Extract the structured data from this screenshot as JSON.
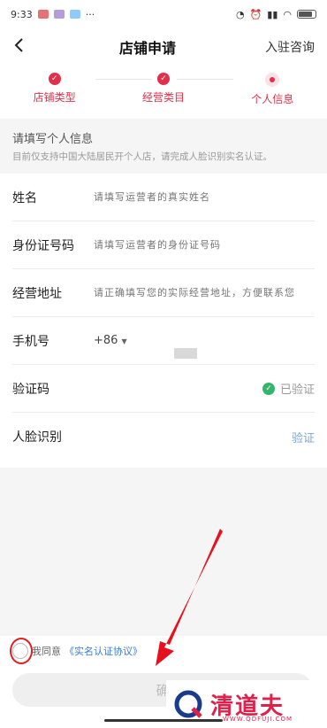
{
  "status_bar": {
    "time": "9:33",
    "dots": "···"
  },
  "nav": {
    "back_icon": "back-arrow-icon",
    "title": "店铺申请",
    "action": "入驻咨询"
  },
  "steps": [
    {
      "label": "店铺类型",
      "state": "done"
    },
    {
      "label": "经营类目",
      "state": "done"
    },
    {
      "label": "个人信息",
      "state": "current"
    }
  ],
  "info": {
    "title": "请填写个人信息",
    "desc": "目前仅支持中国大陆居民开个人店，请完成人脸识别实名认证。"
  },
  "form": {
    "name": {
      "label": "姓名",
      "placeholder": "请填写运营者的真实姓名"
    },
    "id_number": {
      "label": "身份证号码",
      "placeholder": "请填写运营者的身份证号码"
    },
    "address": {
      "label": "经营地址",
      "placeholder": "请正确填写您的实际经营地址，方便联系您"
    },
    "phone": {
      "label": "手机号",
      "country_code": "+86"
    },
    "code": {
      "label": "验证码",
      "status": "已验证"
    },
    "face": {
      "label": "人脸识别",
      "action": "验证"
    }
  },
  "agreement": {
    "prefix": "我同意",
    "link": "《实名认证协议》"
  },
  "confirm_button": {
    "label": "确"
  },
  "watermark": {
    "brand": "清道夫",
    "url": "WWW.QDFUJI.COM"
  },
  "colors": {
    "accent": "#e0304a",
    "verified": "#35b46c",
    "link": "#3a7bd5"
  }
}
